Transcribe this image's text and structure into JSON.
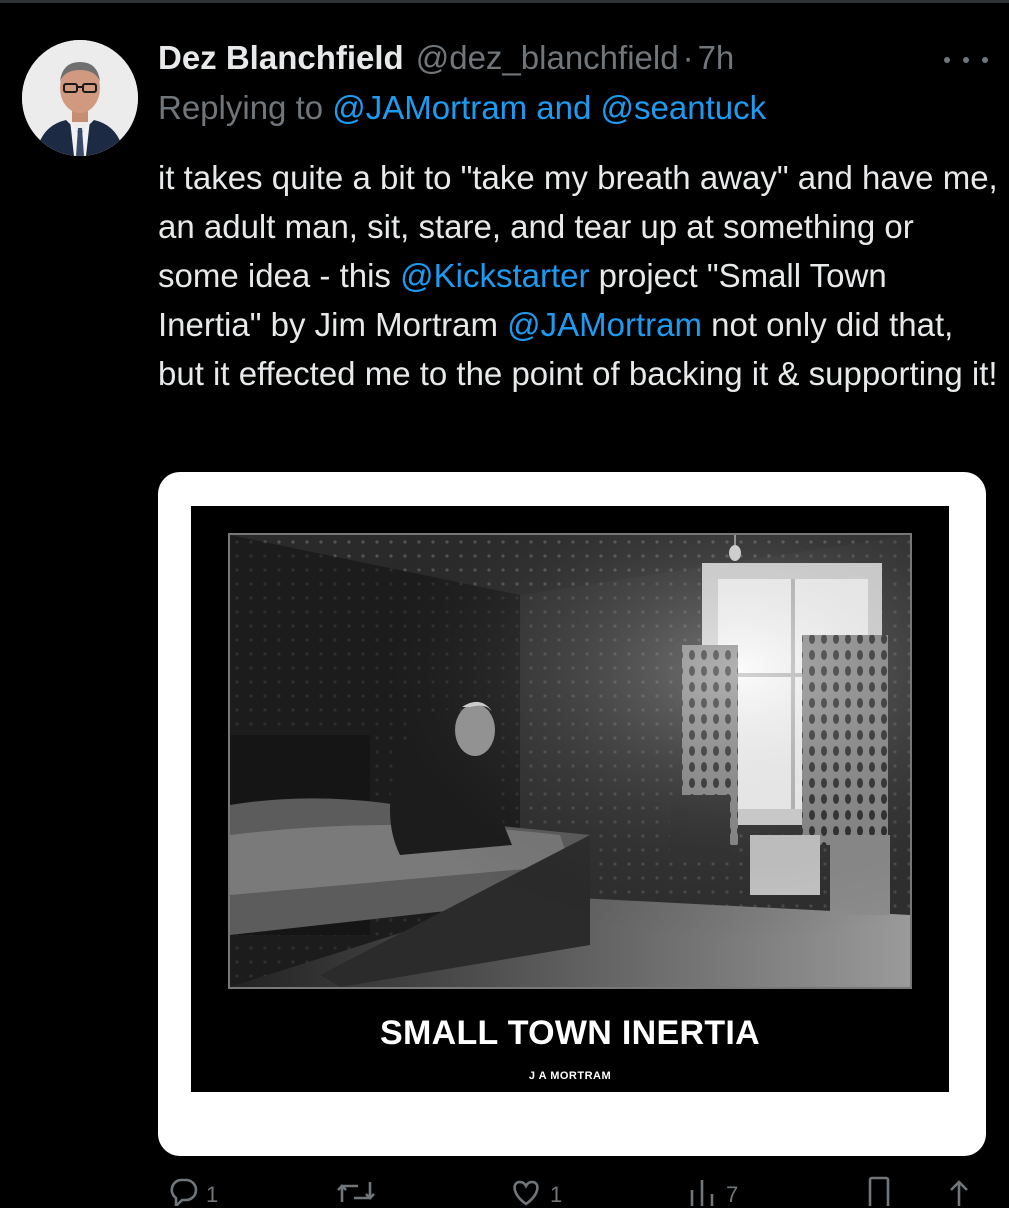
{
  "tweet": {
    "display_name": "Dez Blanchfield",
    "handle": "@dez_blanchfield",
    "separator": "·",
    "time": "7h",
    "reply_prefix": "Replying to",
    "reply_to_1": "@JAMortram",
    "reply_and": "and",
    "reply_to_2": "@seantuck",
    "text": {
      "part1": "it takes quite a bit to \"take my breath away\" and have me, an adult man, sit, stare, and tear up at something or some idea - this ",
      "mention1": "@Kickstarter",
      "part2": " project \"Small Town Inertia\" by Jim Mortram ",
      "mention2": "@JAMortram",
      "part3": " not only did that, but it effected me to the point of backing it & supporting it!"
    },
    "media": {
      "title": "SMALL TOWN INERTIA",
      "author": "J A MORTRAM"
    },
    "actions": {
      "reply_count": "1",
      "retweet_count": "",
      "like_count": "1",
      "views_count": "7",
      "icons": [
        "reply-icon",
        "retweet-icon",
        "like-icon",
        "views-icon",
        "bookmark-icon",
        "share-icon"
      ]
    }
  },
  "colors": {
    "background": "#000000",
    "text": "#e7e9ea",
    "secondary": "#71767b",
    "link": "#1d9bf0"
  }
}
